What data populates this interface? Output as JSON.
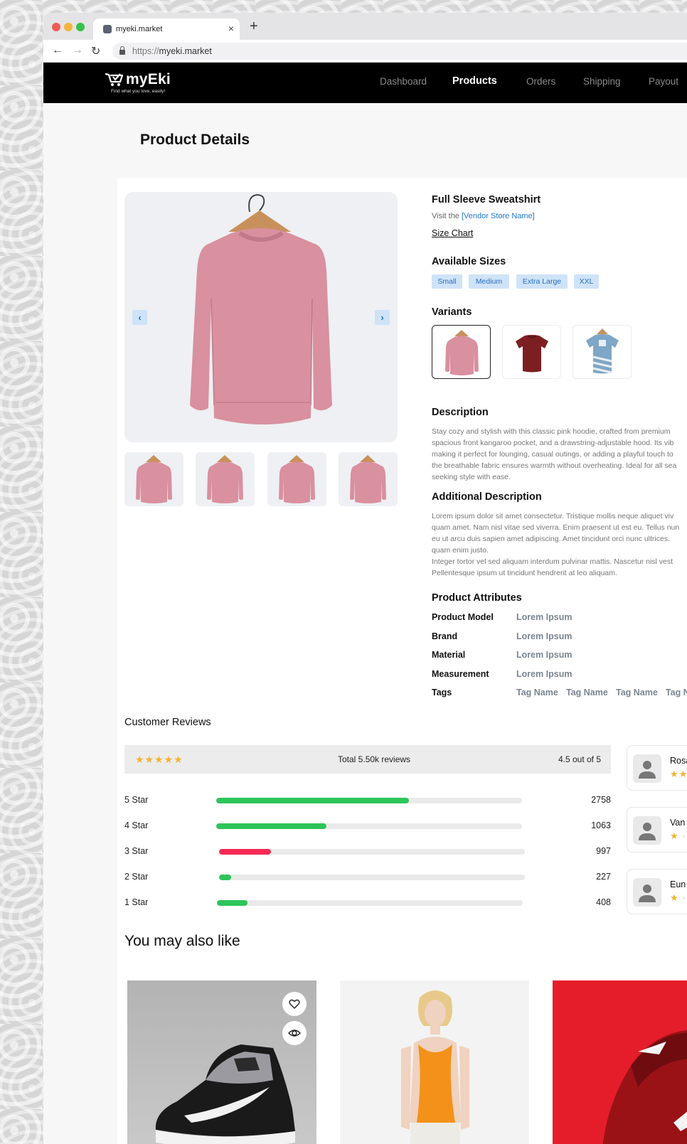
{
  "browser": {
    "tab_title": "myeki.market",
    "tab_close": "×",
    "tab_new": "+",
    "back": "←",
    "forward": "→",
    "reload": "↻",
    "url_scheme": "https://",
    "url_host": "myeki.market"
  },
  "header": {
    "logo_name": "myEki",
    "logo_tagline": "Find what you love, easily!",
    "nav": [
      {
        "label": "Dashboard",
        "active": false
      },
      {
        "label": "Products",
        "active": true
      },
      {
        "label": "Orders",
        "active": false
      },
      {
        "label": "Shipping",
        "active": false
      },
      {
        "label": "Payout",
        "active": false
      }
    ]
  },
  "page": {
    "title": "Product Details"
  },
  "gallery": {
    "prev_label": "‹",
    "next_label": "›",
    "thumbnail_count": 4
  },
  "product": {
    "name": "Full Sleeve Sweatshirt",
    "visit_prefix": "Visit the ",
    "vendor_link": "[Vendor Store Name]",
    "size_chart": "Size Chart",
    "sizes_heading": "Available Sizes",
    "sizes": [
      "Small",
      "Medium",
      "Extra Large",
      "XXL"
    ],
    "variants_heading": "Variants",
    "description_heading": "Description",
    "description_lines": [
      "Stay cozy and stylish with this classic pink hoodie, crafted from premium",
      "spacious front kangaroo pocket, and a drawstring-adjustable hood. Its vib",
      "making it perfect for lounging, casual outings, or adding a playful touch to",
      "the breathable fabric ensures warmth without overheating. Ideal for all sea",
      "seeking style with ease."
    ],
    "additional_heading": "Additional Description",
    "additional_lines": [
      "Lorem ipsum dolor sit amet consectetur. Tristique mollis neque aliquet viv",
      "quam amet. Nam nisl vitae sed viverra. Enim praesent ut est eu. Tellus nun",
      "eu ut arcu duis sapien amet adipiscing. Amet tincidunt orci nunc ultrices.",
      "quam enim justo.",
      "Integer tortor vel sed aliquam interdum pulvinar mattis. Nascetur nisl vest",
      "Pellentesque ipsum ut tincidunt hendrerit at leo aliquam."
    ],
    "attributes_heading": "Product Attributes",
    "attributes": [
      {
        "label": "Product Model",
        "value": "Lorem Ipsum"
      },
      {
        "label": "Brand",
        "value": "Lorem Ipsum"
      },
      {
        "label": "Material",
        "value": "Lorem Ipsum"
      },
      {
        "label": "Measurement",
        "value": "Lorem Ipsum"
      }
    ],
    "tags_label": "Tags",
    "tags": [
      "Tag Name",
      "Tag Name",
      "Tag Name",
      "Tag N"
    ]
  },
  "reviews": {
    "title": "Customer Reviews",
    "stars": "★★★★★",
    "total": "Total 5.50k reviews",
    "out_of": "4.5 out of 5",
    "breakdown": [
      {
        "label": "5 Star",
        "fraction": 0.63,
        "color": "#2ec55a",
        "count": "2758"
      },
      {
        "label": "4 Star",
        "fraction": 0.36,
        "color": "#2ec55a",
        "count": "1063"
      },
      {
        "label": "3 Star",
        "fraction": 0.17,
        "color": "#f42a55",
        "count": "997"
      },
      {
        "label": "2 Star",
        "fraction": 0.04,
        "color": "#2ec55a",
        "count": "227"
      },
      {
        "label": "1 Star",
        "fraction": 0.1,
        "color": "#2ec55a",
        "count": "408"
      }
    ],
    "cards": [
      {
        "name": "Rosal",
        "stars": "★★"
      },
      {
        "name": "Van",
        "stars": "★ ·"
      },
      {
        "name": "Eun",
        "stars": "★ ·"
      }
    ]
  },
  "also_like": {
    "title": "You may also like"
  },
  "icons": {
    "wishlist": "heart-icon",
    "quick_view": "eye-icon",
    "avatar": "user-icon"
  },
  "colors": {
    "accent": "#1f78d1",
    "chip_bg": "#cfe3f8",
    "star": "#f3b233",
    "bar_green": "#2ec55a",
    "bar_red": "#f42a55",
    "header_bg": "#000000"
  }
}
